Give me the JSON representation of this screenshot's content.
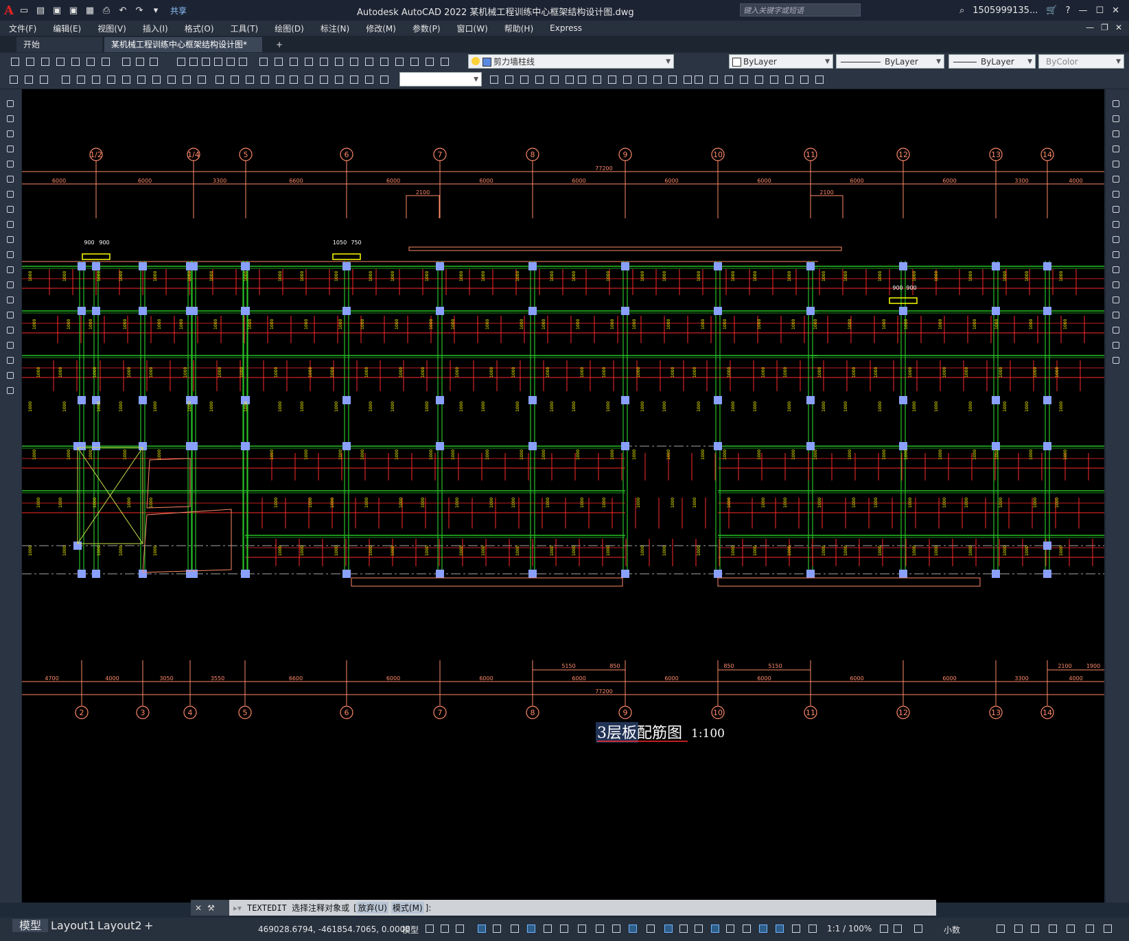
{
  "app": {
    "title": "Autodesk AutoCAD 2022    某机械工程训练中心框架结构设计图.dwg",
    "share_label": "共享",
    "search_placeholder": "键入关键字或短语",
    "user": "1505999135...",
    "logo": "A"
  },
  "menu": [
    "文件(F)",
    "编辑(E)",
    "视图(V)",
    "插入(I)",
    "格式(O)",
    "工具(T)",
    "绘图(D)",
    "标注(N)",
    "修改(M)",
    "参数(P)",
    "窗口(W)",
    "帮助(H)",
    "Express"
  ],
  "doc_tabs": {
    "start": "开始",
    "active": "某机械工程训练中心框架结构设计图*",
    "close": "×",
    "add": "+"
  },
  "props": {
    "layer": "剪力墙柱线",
    "color": "ByLayer",
    "linetype": "ByLayer",
    "lineweight": "ByLayer",
    "plotstyle": "ByColor"
  },
  "drawing": {
    "grid_top": [
      "1/2",
      "1/4",
      "5",
      "6",
      "7",
      "8",
      "9",
      "10",
      "11",
      "12",
      "13",
      "14"
    ],
    "grid_bottom": [
      "2",
      "3",
      "4",
      "5",
      "6",
      "7",
      "8",
      "9",
      "10",
      "11",
      "12",
      "13",
      "14"
    ],
    "dims_top": [
      "6000",
      "6000",
      "3300",
      "6600",
      "6000",
      "6000",
      "6000",
      "6000",
      "6000",
      "6000",
      "6000",
      "3300",
      "4000"
    ],
    "dims_bottom": [
      "4700",
      "4000",
      "3050",
      "3550",
      "6600",
      "6000",
      "6000",
      "6000",
      "6000",
      "6000",
      "6000",
      "6000",
      "3300",
      "4000"
    ],
    "total_top": "77200",
    "total_bottom": "77200",
    "sub_top": [
      "2100",
      "2100"
    ],
    "sub_bottom": [
      "5150",
      "850",
      "850",
      "5150",
      "2100",
      "1900"
    ],
    "brackets": [
      "900",
      "900",
      "1050",
      "750",
      "900",
      "900"
    ],
    "caption": "3层板配筋图",
    "scale": "1:100"
  },
  "command": {
    "text": "TEXTEDIT 选择注释对象或",
    "opt1": "放弃(U)",
    "opt2": "模式(M)",
    "tail": "]:",
    "bracket": "["
  },
  "layouts": [
    "模型",
    "Layout1",
    "Layout2",
    "+"
  ],
  "status": {
    "coords": "469028.6794, -461854.7065, 0.0000",
    "model": "模型",
    "scale": "1:1 / 100%",
    "units": "小数"
  },
  "colors": {
    "canvas": "#000000",
    "grid_red": "#ff2a2a",
    "beam_green": "#27c027",
    "axis": "#ff8a6a",
    "text_yellow": "#ffff00",
    "column": "#8aa0ff"
  }
}
